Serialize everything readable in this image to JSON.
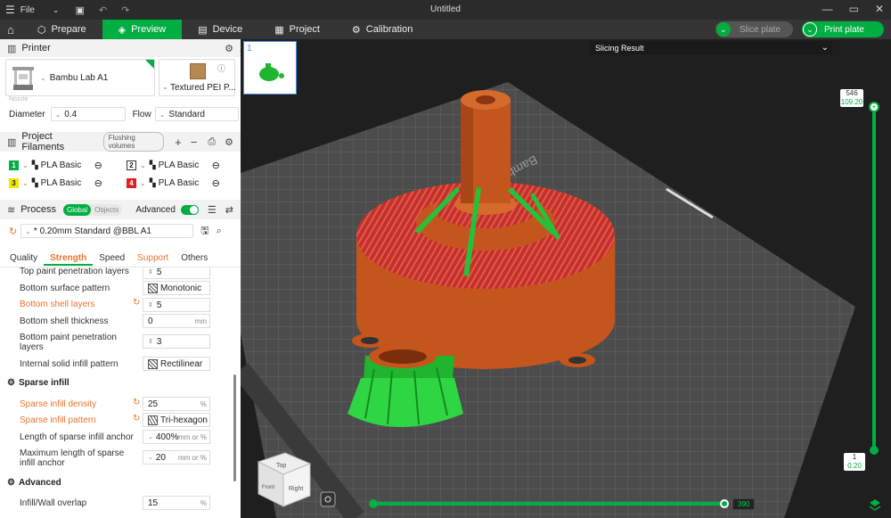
{
  "titlebar": {
    "menu": "File",
    "title": "Untitled"
  },
  "tabs": [
    {
      "label": "Prepare"
    },
    {
      "label": "Preview"
    },
    {
      "label": "Device"
    },
    {
      "label": "Project"
    },
    {
      "label": "Calibration"
    }
  ],
  "actions": {
    "slice": "Slice plate",
    "print": "Print plate"
  },
  "printer": {
    "heading": "Printer",
    "name": "Bambu Lab A1",
    "plate": "Textured PEI P...",
    "nozzle_label": "Nozzle",
    "diameter_label": "Diameter",
    "diameter_value": "0.4",
    "flow_label": "Flow",
    "flow_value": "Standard"
  },
  "filaments": {
    "heading": "Project Filaments",
    "flushing": "Flushing volumes",
    "items": [
      {
        "num": "1",
        "name": "PLA Basic",
        "color": "#00ae42",
        "text_color": "#ffffff"
      },
      {
        "num": "2",
        "name": "PLA Basic",
        "color": "#ffffff",
        "text_color": "#222222"
      },
      {
        "num": "3",
        "name": "PLA Basic",
        "color": "#f5e600",
        "text_color": "#222222"
      },
      {
        "num": "4",
        "name": "PLA Basic",
        "color": "#e02020",
        "text_color": "#ffffff"
      }
    ]
  },
  "process": {
    "heading": "Process",
    "global": "Global",
    "objects": "Objects",
    "advanced": "Advanced",
    "preset": "* 0.20mm Standard @BBL A1",
    "subtabs": [
      "Quality",
      "Strength",
      "Speed",
      "Support",
      "Others"
    ]
  },
  "settings": [
    {
      "label": "Top paint penetration layers",
      "value": "5",
      "unit": ""
    },
    {
      "label": "Bottom surface pattern",
      "value": "Monotonic",
      "unit": ""
    },
    {
      "label": "Bottom shell layers",
      "value": "5",
      "unit": ""
    },
    {
      "label": "Bottom shell thickness",
      "value": "0",
      "unit": "mm"
    },
    {
      "label": "Bottom paint penetration layers",
      "value": "3",
      "unit": ""
    },
    {
      "label": "Internal solid infill pattern",
      "value": "Rectilinear",
      "unit": ""
    },
    {
      "label": "Sparse infill density",
      "value": "25",
      "unit": "%"
    },
    {
      "label": "Sparse infill pattern",
      "value": "Tri-hexagon",
      "unit": ""
    },
    {
      "label": "Length of sparse infill anchor",
      "value": "400%",
      "unit": "mm or %"
    },
    {
      "label": "Maximum length of sparse infill anchor",
      "value": "20",
      "unit": "mm or %"
    },
    {
      "label": "Infill/Wall overlap",
      "value": "15",
      "unit": "%"
    }
  ],
  "groups": {
    "sparse": "Sparse infill",
    "advanced": "Advanced"
  },
  "viewport": {
    "slicing_result": "Slicing Result",
    "thumb_num": "1",
    "plate_text": "Bambu Textured PEI Plate",
    "vslider_top_layer": "546",
    "vslider_top_height": "109.20",
    "vslider_bottom_layer": "1",
    "vslider_bottom_height": "0.20",
    "hslider_value": "390",
    "cube_top": "Top",
    "cube_front": "Front",
    "cube_right": "Right"
  }
}
